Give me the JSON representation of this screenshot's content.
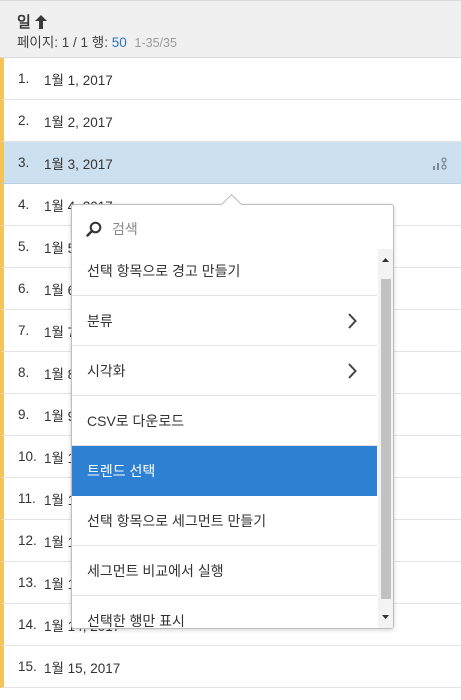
{
  "header": {
    "column_title": "일",
    "page_label": "페이지: 1 / 1",
    "rows_label": "행:",
    "rows_value": "50",
    "range": "1-35/35"
  },
  "rows": [
    {
      "index": "1.",
      "label": "1월 1, 2017"
    },
    {
      "index": "2.",
      "label": "1월 2, 2017"
    },
    {
      "index": "3.",
      "label": "1월 3, 2017"
    },
    {
      "index": "4.",
      "label": "1월 4, 2017"
    },
    {
      "index": "5.",
      "label": "1월 5, 2017"
    },
    {
      "index": "6.",
      "label": "1월 6, 2017"
    },
    {
      "index": "7.",
      "label": "1월 7, 2017"
    },
    {
      "index": "8.",
      "label": "1월 8, 2017"
    },
    {
      "index": "9.",
      "label": "1월 9, 2017"
    },
    {
      "index": "10.",
      "label": "1월 10, 2017"
    },
    {
      "index": "11.",
      "label": "1월 11, 2017"
    },
    {
      "index": "12.",
      "label": "1월 12, 2017"
    },
    {
      "index": "13.",
      "label": "1월 13, 2017"
    },
    {
      "index": "14.",
      "label": "1월 14, 2017"
    },
    {
      "index": "15.",
      "label": "1월 15, 2017"
    }
  ],
  "selected_row": 3,
  "popover": {
    "search_placeholder": "검색",
    "items": [
      {
        "label": "선택 항목으로 경고 만들기"
      },
      {
        "label": "분류",
        "has_submenu": true
      },
      {
        "label": "시각화",
        "has_submenu": true
      },
      {
        "label": "CSV로 다운로드"
      },
      {
        "label": "트렌드 선택",
        "active": true
      },
      {
        "label": "선택 항목으로 세그먼트 만들기"
      },
      {
        "label": "세그먼트 비교에서 실행"
      },
      {
        "label": "선택한 행만 표시"
      }
    ]
  },
  "colors": {
    "accent": "#2d80d2",
    "row_marker": "#f4c45a",
    "selected_row_bg": "#cde0f0",
    "header_bg": "#f0f0f0"
  },
  "icons": {
    "sort": "arrow-up-icon",
    "trend": "trend-icon",
    "search": "search-icon",
    "submenu": "chevron-right-icon"
  }
}
